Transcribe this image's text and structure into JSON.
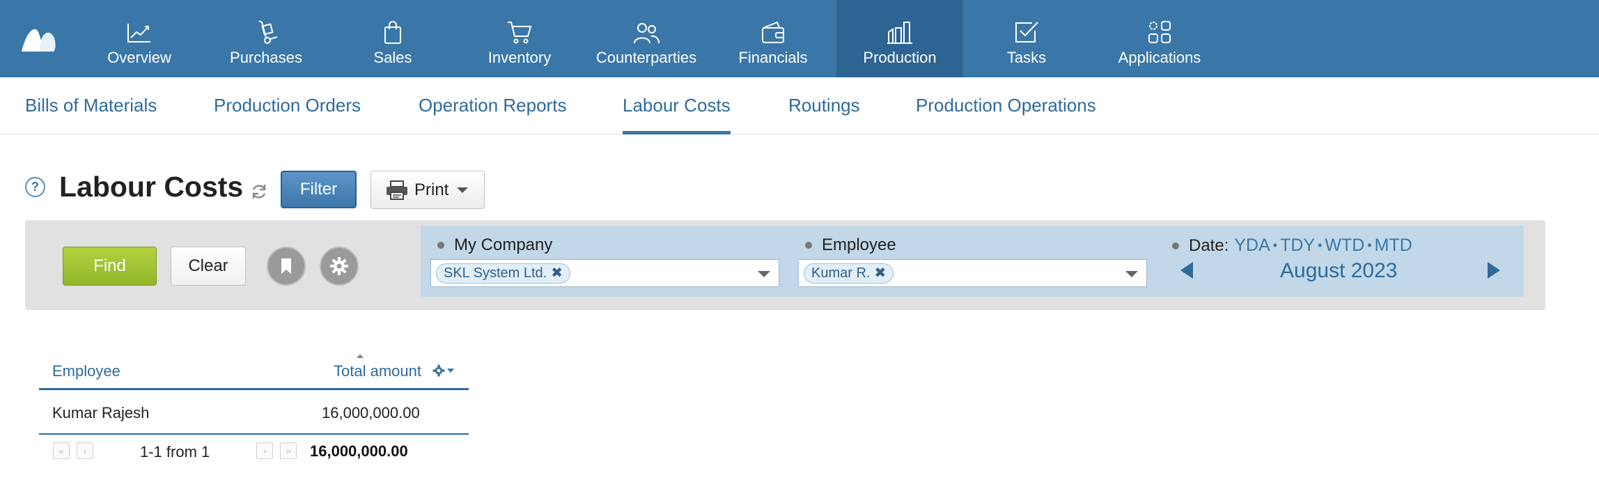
{
  "topnav": {
    "items": [
      {
        "label": "Overview",
        "icon": "chart-line-icon"
      },
      {
        "label": "Purchases",
        "icon": "hand-truck-icon"
      },
      {
        "label": "Sales",
        "icon": "shopping-bag-icon"
      },
      {
        "label": "Inventory",
        "icon": "cart-icon"
      },
      {
        "label": "Counterparties",
        "icon": "people-icon"
      },
      {
        "label": "Financials",
        "icon": "wallet-icon"
      },
      {
        "label": "Production",
        "icon": "factory-icon",
        "active": true
      },
      {
        "label": "Tasks",
        "icon": "checkbox-icon"
      },
      {
        "label": "Applications",
        "icon": "apps-grid-icon"
      }
    ]
  },
  "subnav": {
    "tabs": [
      {
        "label": "Bills of Materials"
      },
      {
        "label": "Production Orders"
      },
      {
        "label": "Operation Reports"
      },
      {
        "label": "Labour Costs",
        "active": true
      },
      {
        "label": "Routings"
      },
      {
        "label": "Production Operations"
      }
    ]
  },
  "page": {
    "help": "?",
    "title": "Labour Costs",
    "filter_label": "Filter",
    "print_label": "Print"
  },
  "filter": {
    "find_label": "Find",
    "clear_label": "Clear",
    "company_label": "My Company",
    "company_value": "SKL System Ltd.",
    "employee_label": "Employee",
    "employee_value": "Kumar R.",
    "date_label": "Date:",
    "date_shortcuts": [
      "YDA",
      "TDY",
      "WTD",
      "MTD"
    ],
    "period": "August 2023"
  },
  "table": {
    "headers": {
      "employee": "Employee",
      "total": "Total amount"
    },
    "rows": [
      {
        "employee": "Kumar Rajesh",
        "total": "16,000,000.00"
      }
    ],
    "pager_info": "1-1 from 1",
    "grand_total": "16,000,000.00"
  },
  "colors": {
    "nav_bg": "#3a77a8",
    "nav_active": "#2d6491",
    "link": "#2f6a9b",
    "find_green": "#a3c435",
    "filter_fields_bg": "#c2d8e8"
  }
}
